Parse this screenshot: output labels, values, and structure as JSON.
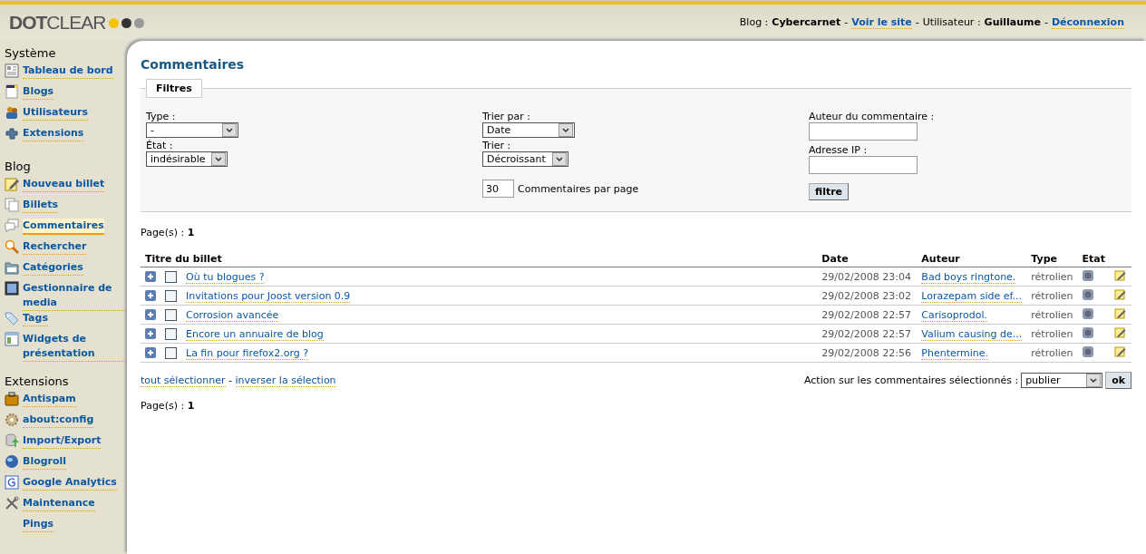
{
  "header": {
    "logo": "**DOT**CLEAR",
    "blog_label": "Blog :",
    "blog_name": "Cybercarnet",
    "view_site": "Voir le site",
    "user_label": "Utilisateur :",
    "user_name": "Guillaume",
    "logout": "Déconnexion",
    "separators": [
      "-",
      "-",
      "-"
    ]
  },
  "sidebar": [
    {
      "heading": "Système",
      "items": [
        {
          "label": "Tableau de bord",
          "selected": false
        },
        {
          "label": "Blogs",
          "selected": false
        },
        {
          "label": "Utilisateurs",
          "selected": false
        },
        {
          "label": "Extensions",
          "selected": false
        }
      ]
    },
    {
      "heading": "Blog",
      "items": [
        {
          "label": "Nouveau billet",
          "selected": false
        },
        {
          "label": "Billets",
          "selected": false
        },
        {
          "label": "Commentaires",
          "selected": true
        },
        {
          "label": "Rechercher",
          "selected": false
        },
        {
          "label": "Catégories",
          "selected": false
        },
        {
          "label": "Gestionnaire de media",
          "selected": false
        },
        {
          "label": "Tags",
          "selected": false
        },
        {
          "label": "Widgets de présentation",
          "selected": false
        }
      ]
    },
    {
      "heading": "Extensions",
      "items": [
        {
          "label": "Antispam",
          "selected": false
        },
        {
          "label": "about:config",
          "selected": false
        },
        {
          "label": "Import/Export",
          "selected": false
        },
        {
          "label": "Blogroll",
          "selected": false
        },
        {
          "label": "Google Analytics",
          "selected": false
        },
        {
          "label": "Maintenance",
          "selected": false
        },
        {
          "label": "Pings",
          "selected": false
        }
      ]
    }
  ],
  "page_title": "Commentaires",
  "filters": {
    "legend": "Filtres",
    "type": {
      "label": "Type :",
      "value": "-"
    },
    "state": {
      "label": "État :",
      "value": "indésirable"
    },
    "sort_by": {
      "label": "Trier par :",
      "value": "Date"
    },
    "order": {
      "label": "Trier :",
      "value": "Décroissant"
    },
    "per_page": {
      "value": "30",
      "label": "Commentaires par page"
    },
    "author": {
      "label": "Auteur du commentaire :"
    },
    "ip": {
      "label": "Adresse IP :"
    },
    "button": "filtre"
  },
  "pages_top": {
    "label": "Page(s) :",
    "value": "1"
  },
  "table": {
    "columns": [
      "Titre du billet",
      "Date",
      "Auteur",
      "Type",
      "Etat"
    ],
    "rows": [
      {
        "title": "Où tu blogues ?",
        "date": "29/02/2008 23:04",
        "author": "Bad boys ringtone.",
        "type": "rétrolien",
        "checked": false
      },
      {
        "title": "Invitations pour Joost version 0.9",
        "date": "29/02/2008 23:02",
        "author": "Lorazepam side ef...",
        "type": "rétrolien",
        "checked": false
      },
      {
        "title": "Corrosion avancée",
        "date": "29/02/2008 22:57",
        "author": "Carisoprodol.",
        "type": "rétrolien",
        "checked": false
      },
      {
        "title": "Encore un annuaire de blog",
        "date": "29/02/2008 22:57",
        "author": "Valium causing de...",
        "type": "rétrolien",
        "checked": false
      },
      {
        "title": "La fin pour firefox2.org ?",
        "date": "29/02/2008 22:56",
        "author": "Phentermine.",
        "type": "rétrolien",
        "checked": false
      }
    ]
  },
  "select_all": "tout sélectionner",
  "separator": "-",
  "invert": "inverser la sélection",
  "action": {
    "label": "Action sur les commentaires sélectionnés :",
    "value": "publier",
    "button": "ok"
  },
  "pages_bottom": {
    "label": "Page(s) :",
    "value": "1"
  }
}
